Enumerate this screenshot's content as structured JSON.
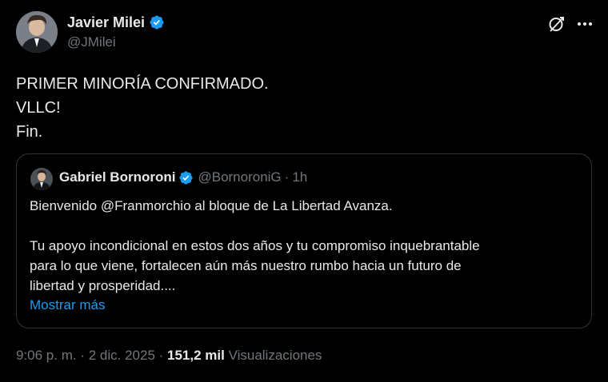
{
  "author": {
    "name": "Javier Milei",
    "handle": "@JMilei",
    "verified": true
  },
  "tweet": {
    "lines": [
      "PRIMER MINORÍA CONFIRMADO.",
      "VLLC!",
      "Fin."
    ]
  },
  "quote": {
    "author_name": "Gabriel Bornoroni",
    "handle": "@BornoroniG",
    "separator": "·",
    "time": "1h",
    "verified": true,
    "paragraph1": "Bienvenido @Franmorchio al bloque de La Libertad Avanza.",
    "paragraph2_lines": [
      "Tu apoyo incondicional en estos dos años y tu compromiso inquebrantable",
      "para lo que viene, fortalecen aún más nuestro rumbo hacia un futuro de",
      "libertad y prosperidad...."
    ],
    "show_more": "Mostrar más"
  },
  "meta": {
    "time": "9:06 p. m.",
    "sep1": " · ",
    "date": "2 dic. 2025",
    "sep2": " · ",
    "views_count": "151,2 mil",
    "views_label": " Visualizaciones"
  },
  "colors": {
    "background": "#000000",
    "text": "#e7e9ea",
    "secondary": "#71767b",
    "link": "#1d9bf0",
    "verified_badge": "#1d9bf0",
    "border": "#2f3336"
  },
  "icons": {
    "verified": "verified-badge-icon",
    "grok": "grok-icon",
    "more": "more-icon"
  }
}
